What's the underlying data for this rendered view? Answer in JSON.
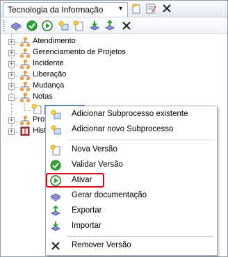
{
  "window": {
    "title": "Tecnologia da Informação",
    "title_arrow": "▾"
  },
  "toolbar": {
    "icons": [
      "layers-icon",
      "validate-icon",
      "activate-icon",
      "new-subprocess-icon",
      "new-version-icon",
      "import-icon",
      "export-icon",
      "remove-icon"
    ]
  },
  "tree": {
    "nodes": [
      {
        "label": "Atendimento",
        "expander": "+"
      },
      {
        "label": "Gerenciamento de Projetos",
        "expander": "+"
      },
      {
        "label": "Incidente",
        "expander": "+"
      },
      {
        "label": "Liberação",
        "expander": "+"
      },
      {
        "label": "Mudança",
        "expander": "+"
      },
      {
        "label": "Notas",
        "expander": "−"
      },
      {
        "label": "Prob",
        "expander": "+"
      },
      {
        "label": "Hist",
        "expander": "+"
      }
    ]
  },
  "context_menu": {
    "items": [
      {
        "label": "Adicionar Subprocesso existente",
        "icon": "add-existing-subprocess-icon"
      },
      {
        "label": "Adicionar novo Subprocesso",
        "icon": "add-new-subprocess-icon"
      },
      {
        "label": "Nova Versão",
        "icon": "new-version-icon"
      },
      {
        "label": "Validar Versão",
        "icon": "validate-icon"
      },
      {
        "label": "Ativar",
        "icon": "activate-icon"
      },
      {
        "label": "Gerar documentação",
        "icon": "documentation-icon"
      },
      {
        "label": "Exportar",
        "icon": "export-icon"
      },
      {
        "label": "Importar",
        "icon": "import-icon"
      },
      {
        "label": "Remover Versão",
        "icon": "remove-icon"
      }
    ],
    "highlighted_item": "Ativar",
    "highlight_color": "#e0001a"
  },
  "colors": {
    "selection": "#3a70c8",
    "validate_green": "#2fa52f",
    "highlight_red": "#e0001a"
  }
}
